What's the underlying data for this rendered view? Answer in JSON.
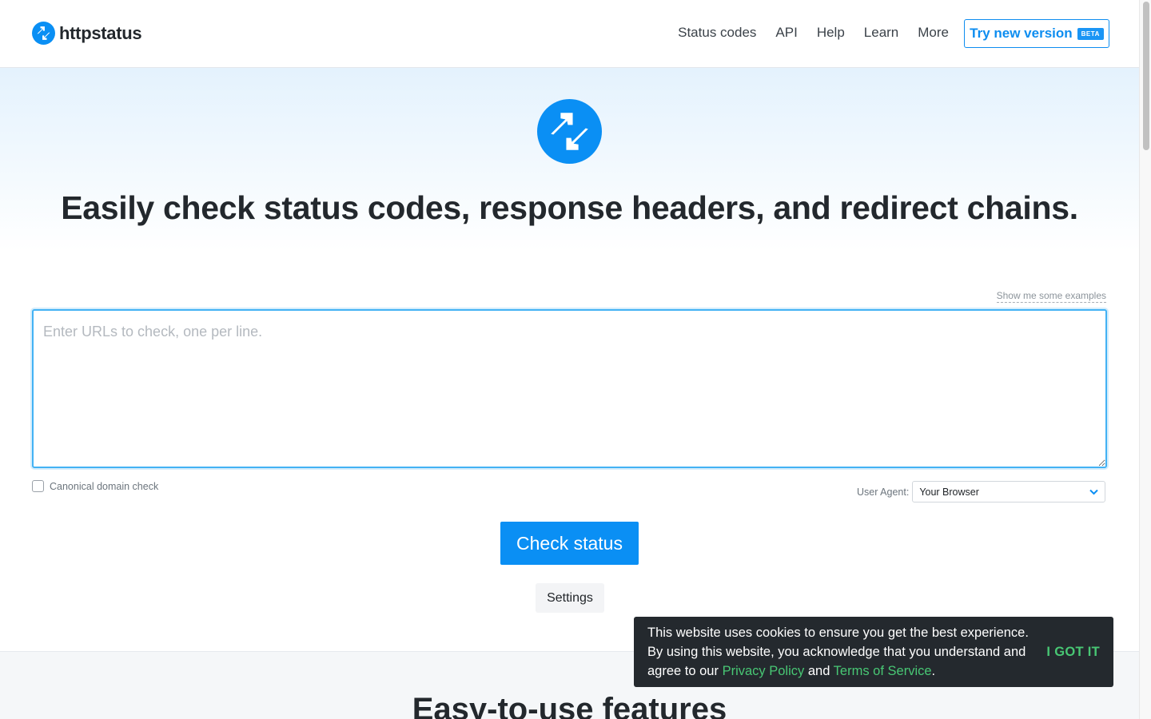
{
  "brand": {
    "name": "httpstatus",
    "accent": "#0a8ff4"
  },
  "nav": {
    "items": [
      {
        "label": "Status codes"
      },
      {
        "label": "API"
      },
      {
        "label": "Help"
      },
      {
        "label": "Learn"
      },
      {
        "label": "More"
      }
    ],
    "try_label": "Try new version",
    "beta_badge": "BETA"
  },
  "hero": {
    "headline_parts": {
      "p1": "Easily check ",
      "b1": "status codes",
      "p2": ", ",
      "b2": "response headers",
      "p3": ", and ",
      "b3": "redirect chains",
      "p4": "."
    },
    "examples_link": "Show me some examples",
    "url_placeholder": "Enter URLs to check, one per line.",
    "canonical_label": "Canonical domain check",
    "canonical_checked": false,
    "ua_label": "User Agent:",
    "ua_value": "Your Browser",
    "check_button": "Check status",
    "settings_button": "Settings"
  },
  "features": {
    "title": "Easy-to-use features"
  },
  "cookie": {
    "line1": "This website uses cookies to ensure you get the best experience. By using this website, you acknowledge that you understand and agree to our ",
    "privacy_link": "Privacy Policy",
    "and_text": " and ",
    "terms_link": "Terms of Service",
    "end_text": ".",
    "ok_button": "I GOT IT"
  }
}
